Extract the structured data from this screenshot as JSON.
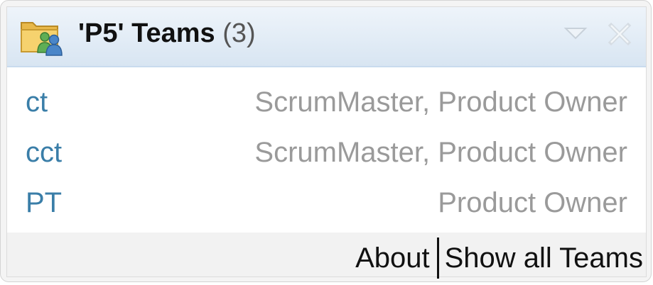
{
  "header": {
    "icon": "team-folder-icon",
    "title": "'P5' Teams",
    "count": "(3)",
    "menu_icon": "dropdown-triangle-icon",
    "close_icon": "close-icon"
  },
  "teams": [
    {
      "name": "ct",
      "roles": "ScrumMaster, Product Owner"
    },
    {
      "name": "cct",
      "roles": "ScrumMaster, Product Owner"
    },
    {
      "name": "PT",
      "roles": "Product Owner"
    }
  ],
  "footer": {
    "about_label": "About",
    "show_all_label": "Show all Teams"
  },
  "colors": {
    "link": "#3a7ea8",
    "roles": "#9a9a9a",
    "header_bg": "#e2ecf6"
  }
}
